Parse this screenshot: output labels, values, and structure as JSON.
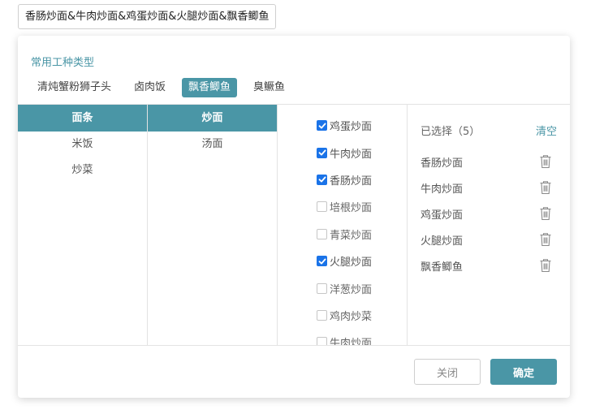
{
  "selection_input": {
    "value": "香肠炒面&牛肉炒面&鸡蛋炒面&火腿炒面&飘香鲫鱼"
  },
  "section_title": "常用工种类型",
  "quick_tags": [
    {
      "label": "清炖蟹粉狮子头",
      "active": false
    },
    {
      "label": "卤肉饭",
      "active": false
    },
    {
      "label": "飘香鲫鱼",
      "active": true
    },
    {
      "label": "臭鳜鱼",
      "active": false
    }
  ],
  "column1": [
    {
      "label": "面条",
      "active": true
    },
    {
      "label": "米饭",
      "active": false
    },
    {
      "label": "炒菜",
      "active": false
    }
  ],
  "column2": [
    {
      "label": "炒面",
      "active": true
    },
    {
      "label": "汤面",
      "active": false
    }
  ],
  "column3": [
    {
      "label": "鸡蛋炒面",
      "checked": true
    },
    {
      "label": "牛肉炒面",
      "checked": true
    },
    {
      "label": "香肠炒面",
      "checked": true
    },
    {
      "label": "培根炒面",
      "checked": false
    },
    {
      "label": "青菜炒面",
      "checked": false
    },
    {
      "label": "火腿炒面",
      "checked": true
    },
    {
      "label": "洋葱炒面",
      "checked": false
    },
    {
      "label": "鸡肉炒菜",
      "checked": false
    },
    {
      "label": "牛肉炒面",
      "checked": false
    }
  ],
  "selected": {
    "title": "已选择（5）",
    "clear_label": "清空",
    "items": [
      "香肠炒面",
      "牛肉炒面",
      "鸡蛋炒面",
      "火腿炒面",
      "飘香鲫鱼"
    ]
  },
  "footer": {
    "close_label": "关闭",
    "confirm_label": "确定"
  },
  "colors": {
    "accent": "#4a96a6",
    "checkbox": "#1a73e8"
  }
}
